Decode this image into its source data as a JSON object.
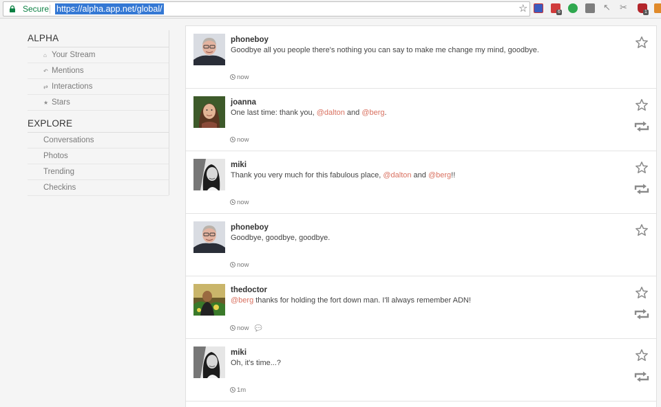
{
  "browser": {
    "secure_label": "Secure",
    "url": "https://alpha.app.net/global/",
    "ext_badges": [
      "6",
      "1"
    ]
  },
  "sidebar": {
    "alpha_heading": "ALPHA",
    "alpha_items": [
      {
        "label": "Your Stream",
        "icon": "house-icon"
      },
      {
        "label": "Mentions",
        "icon": "reply-icon"
      },
      {
        "label": "Interactions",
        "icon": "interactions-icon"
      },
      {
        "label": "Stars",
        "icon": "star-icon"
      }
    ],
    "explore_heading": "EXPLORE",
    "explore_items": [
      {
        "label": "Conversations"
      },
      {
        "label": "Photos"
      },
      {
        "label": "Trending"
      },
      {
        "label": "Checkins"
      }
    ]
  },
  "colors": {
    "mention": "#d9705f",
    "accent": "#3478d4"
  },
  "posts": [
    {
      "username": "phoneboy",
      "segments": [
        {
          "t": "Goodbye all you people there's nothing you can say to make me change my mind, goodbye."
        }
      ],
      "time": "now",
      "repost": false,
      "conversation": false,
      "avatar": "avatar-phoneboy"
    },
    {
      "username": "joanna",
      "segments": [
        {
          "t": "One last time: thank you, "
        },
        {
          "t": "@dalton",
          "m": true
        },
        {
          "t": " and "
        },
        {
          "t": "@berg",
          "m": true
        },
        {
          "t": "."
        }
      ],
      "time": "now",
      "repost": true,
      "conversation": false,
      "avatar": "avatar-joanna"
    },
    {
      "username": "miki",
      "segments": [
        {
          "t": "Thank you very much for this fabulous place, "
        },
        {
          "t": "@dalton",
          "m": true
        },
        {
          "t": " and "
        },
        {
          "t": "@berg",
          "m": true
        },
        {
          "t": "!!"
        }
      ],
      "time": "now",
      "repost": true,
      "conversation": false,
      "avatar": "avatar-miki"
    },
    {
      "username": "phoneboy",
      "segments": [
        {
          "t": "Goodbye, goodbye, goodbye."
        }
      ],
      "time": "now",
      "repost": false,
      "conversation": false,
      "avatar": "avatar-phoneboy"
    },
    {
      "username": "thedoctor",
      "segments": [
        {
          "t": "@berg",
          "m": true
        },
        {
          "t": " thanks for holding the fort down man. I'll always remember ADN!"
        }
      ],
      "time": "now",
      "repost": true,
      "conversation": true,
      "avatar": "avatar-thedoctor"
    },
    {
      "username": "miki",
      "segments": [
        {
          "t": "Oh, it's time...?"
        }
      ],
      "time": "1m",
      "repost": true,
      "conversation": false,
      "avatar": "avatar-miki"
    }
  ]
}
